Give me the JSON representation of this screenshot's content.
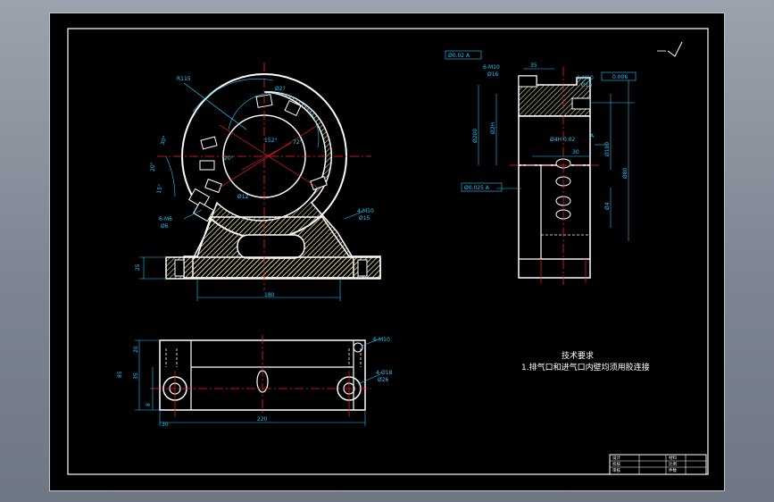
{
  "colors": {
    "background_frame": "#8a939e",
    "sheet": "#000000",
    "outline": "#ffffff",
    "dimension": "#27c5ff",
    "centerline": "#ff2020",
    "hatch": "#e8e0a0"
  },
  "front_view": {
    "dims": {
      "r_outer": "R115",
      "arc_top": "Ø2?",
      "angle_a": "152°",
      "angle_b": "72°",
      "angle_c": "30°",
      "angle_d": "20°",
      "angle_e": "20°",
      "angle_f": "15°",
      "hole_small": "Ø12",
      "left_hole_a": "6-M6",
      "left_hole_b": "Ø6",
      "right_hole_a": "4-M10",
      "right_hole_b": "Ø15",
      "base_height": "25",
      "base_width": "180"
    }
  },
  "side_view": {
    "gdt_top": "Ø0.02 A",
    "thread_left": "6-M10",
    "thread_left_sub": "Ø16",
    "thread_right": "6-M10",
    "thread_right_sub": "Ø16",
    "width_top": "35",
    "flatness": "0.006",
    "dim_center": "Ø4H 0.02",
    "dim_30": "30",
    "vert_a": "Ø200",
    "vert_b": "Ø2H",
    "vert_c": "Ø100",
    "vert_d": "Ø4",
    "vert_e": "Ø80",
    "gdt_bottom": "Ø0.025 A",
    "datum": "A"
  },
  "top_view": {
    "thread_a": "6-M10",
    "thread_b": "4-Ø18",
    "thread_c": "Ø26",
    "h_85": "85",
    "h_35": "35",
    "h_20": "20",
    "h_8": "8",
    "w_total": "220",
    "w_30": "30"
  },
  "tech_requirements": {
    "title": "技术要求",
    "line1": "1.排气口和进气口内壁均须用胶连接"
  },
  "title_block": {
    "r1c1": "设计",
    "r1c2": "材料",
    "r2c1": "校核",
    "r2c2": "比例",
    "r3c1": "审核",
    "r3c2": "件数"
  }
}
